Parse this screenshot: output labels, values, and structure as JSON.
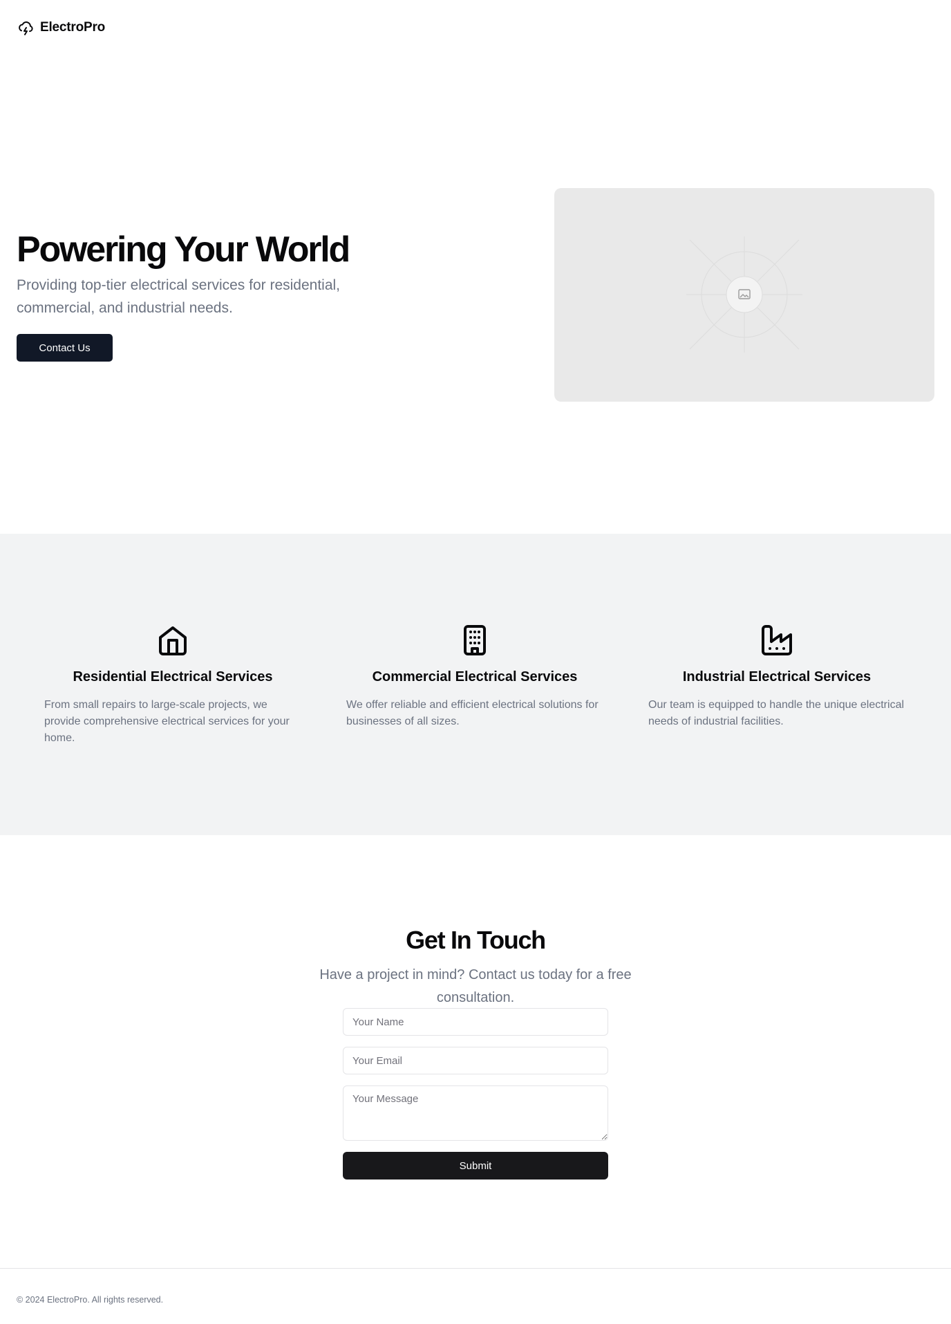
{
  "header": {
    "brand": "ElectroPro",
    "logo_icon": "cloud-lightning-icon"
  },
  "hero": {
    "title": "Powering Your World",
    "subtitle": "Providing top-tier electrical services for residential, commercial, and industrial needs.",
    "cta_label": "Contact Us",
    "image_icon": "image-placeholder-icon"
  },
  "services": {
    "items": [
      {
        "icon": "home-icon",
        "title": "Residential Electrical Services",
        "description": "From small repairs to large-scale projects, we provide comprehensive electrical services for your home."
      },
      {
        "icon": "building-icon",
        "title": "Commercial Electrical Services",
        "description": "We offer reliable and efficient electrical solutions for businesses of all sizes."
      },
      {
        "icon": "factory-icon",
        "title": "Industrial Electrical Services",
        "description": "Our team is equipped to handle the unique electrical needs of industrial facilities."
      }
    ]
  },
  "contact": {
    "title": "Get In Touch",
    "subtitle": "Have a project in mind? Contact us today for a free consultation.",
    "name_placeholder": "Your Name",
    "email_placeholder": "Your Email",
    "message_placeholder": "Your Message",
    "submit_label": "Submit"
  },
  "footer": {
    "copyright": "© 2024 ElectroPro. All rights reserved."
  },
  "colors": {
    "primary_button": "#111827",
    "submit_button": "#18181b",
    "muted_text": "#6b7280",
    "services_bg": "#f2f3f4",
    "image_bg": "#e9e9e9"
  }
}
